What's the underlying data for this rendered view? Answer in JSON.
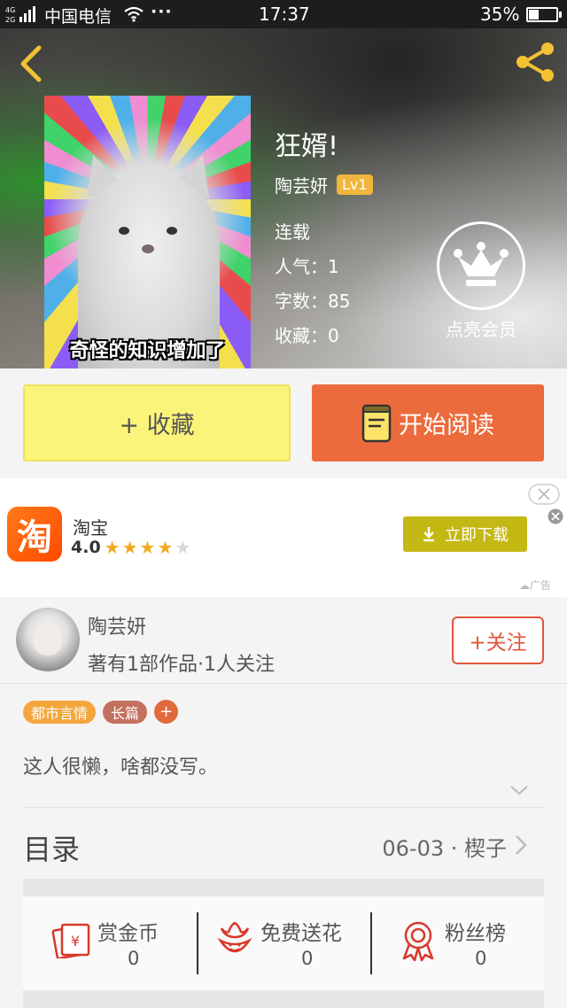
{
  "status_bar": {
    "carrier": "中国电信",
    "time": "17:37",
    "battery": "35%",
    "battery_level": 0.35,
    "network": [
      "4G",
      "2G"
    ]
  },
  "book": {
    "title": "狂婿!",
    "author": "陶芸妍",
    "level": "Lv1",
    "cover_caption": "奇怪的知识增加了",
    "status": "连载",
    "popularity": "人气：1",
    "words": "字数：85",
    "favorites": "收藏：0"
  },
  "vip": {
    "label": "点亮会员"
  },
  "actions": {
    "favorite_label": "+ 收藏",
    "read_label": "开始阅读"
  },
  "ad": {
    "app_icon_char": "淘",
    "app_name": "淘宝",
    "rating": "4.0",
    "stars_filled": 4,
    "stars_total": 5,
    "download_label": "立即下载",
    "ad_label": "广告"
  },
  "author_card": {
    "name": "陶芸妍",
    "works": "著有1部作品·1人关注",
    "follow_label": "+关注"
  },
  "tags": {
    "genre": "都市言情",
    "length": "长篇",
    "add": "+"
  },
  "intro": "这人很懒，啥都没写。",
  "toc": {
    "label": "目录",
    "latest": "06-03 · 楔子"
  },
  "stats": {
    "reward": {
      "title": "赏金币",
      "count": "0"
    },
    "flower": {
      "title": "免费送花",
      "count": "0"
    },
    "fans": {
      "title": "粉丝榜",
      "count": "0"
    }
  },
  "colors": {
    "favorite_button": "#fbf47a",
    "read_button": "#ec6b3c",
    "follow_accent": "#e0563a",
    "level_badge": "#f1b63d",
    "download_button": "#c4b814",
    "star": "#f1a91f"
  },
  "icons": {
    "back": "chevron-left-icon",
    "share": "share-icon",
    "vip": "crown-icon",
    "read": "book-icon",
    "download": "download-icon",
    "reward": "red-envelope-icon",
    "flower": "flower-icon",
    "fans": "medal-icon"
  }
}
